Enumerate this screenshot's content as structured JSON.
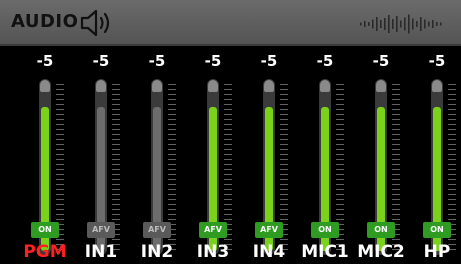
{
  "header": {
    "title": "AUDIO",
    "speaker_icon": "speaker-icon",
    "levels_icon": "audio-levels-icon"
  },
  "channels": [
    {
      "name": "PGM",
      "db": "-5",
      "button": "ON",
      "active": true,
      "level": 0.82,
      "name_color": "#ff2020"
    },
    {
      "name": "IN1",
      "db": "-5",
      "button": "AFV",
      "active": false,
      "level": 0.82,
      "name_color": "#ffffff"
    },
    {
      "name": "IN2",
      "db": "-5",
      "button": "AFV",
      "active": false,
      "level": 0.82,
      "name_color": "#ffffff"
    },
    {
      "name": "IN3",
      "db": "-5",
      "button": "AFV",
      "active": true,
      "level": 0.82,
      "name_color": "#ffffff"
    },
    {
      "name": "IN4",
      "db": "-5",
      "button": "AFV",
      "active": true,
      "level": 0.82,
      "name_color": "#ffffff"
    },
    {
      "name": "MIC1",
      "db": "-5",
      "button": "ON",
      "active": true,
      "level": 0.82,
      "name_color": "#ffffff"
    },
    {
      "name": "MIC2",
      "db": "-5",
      "button": "ON",
      "active": true,
      "level": 0.82,
      "name_color": "#ffffff"
    },
    {
      "name": "HP",
      "db": "-5",
      "button": "ON",
      "active": true,
      "level": 0.82,
      "name_color": "#ffffff"
    }
  ],
  "colors": {
    "active_fill": "#7bd21a",
    "inactive_fill": "#6c6c6c",
    "button_on": "#2f9b22",
    "button_off": "#5a5a5a",
    "button_off_text": "#bdbdbd"
  }
}
